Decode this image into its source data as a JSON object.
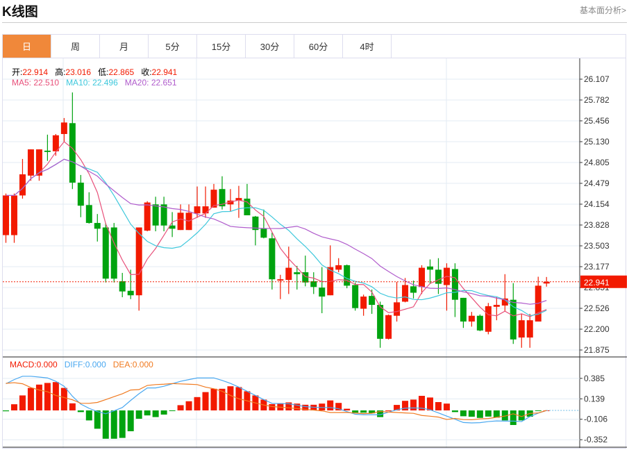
{
  "header": {
    "title": "K线图",
    "link": "基本面分析>"
  },
  "tabs": [
    {
      "label": "日",
      "active": true
    },
    {
      "label": "周"
    },
    {
      "label": "月"
    },
    {
      "label": "5分"
    },
    {
      "label": "15分"
    },
    {
      "label": "30分"
    },
    {
      "label": "60分"
    },
    {
      "label": "4时"
    }
  ],
  "info": {
    "open_label": "开:",
    "open": "22.914",
    "high_label": "高:",
    "high": "23.016",
    "low_label": "低:",
    "low": "22.865",
    "close_label": "收:",
    "close": "22.941",
    "ma5": "MA5: 22.510",
    "ma10": "MA10: 22.496",
    "ma20": "MA20: 22.651",
    "macd": "MACD:0.000",
    "diff": "DIFF:0.000",
    "dea": "DEA:0.000"
  },
  "colors": {
    "up": "#f21a00",
    "down": "#00a30f",
    "ma5": "#e8507a",
    "ma10": "#3ec8dc",
    "ma20": "#b05ccc",
    "diff": "#4aa8f0",
    "dea": "#f07a20",
    "accent": "#f0883a"
  },
  "chart_data": [
    {
      "type": "candlestick",
      "ylim": [
        21.875,
        26.107
      ],
      "y_ticks": [
        "26.107",
        "25.782",
        "25.456",
        "25.130",
        "24.805",
        "24.479",
        "24.154",
        "23.828",
        "23.503",
        "23.177",
        "22.851",
        "22.526",
        "22.200",
        "21.875"
      ],
      "last_price": "22.941",
      "ohlc": [
        [
          23.67,
          24.32,
          23.55,
          24.29
        ],
        [
          23.67,
          24.32,
          23.55,
          24.29
        ],
        [
          24.29,
          24.86,
          24.24,
          24.62
        ],
        [
          24.6,
          25.01,
          24.52,
          25.01
        ],
        [
          24.6,
          25.01,
          24.52,
          25.01
        ],
        [
          24.99,
          25.24,
          24.83,
          24.97
        ],
        [
          24.98,
          25.25,
          24.91,
          25.23
        ],
        [
          25.25,
          25.5,
          25.12,
          25.43
        ],
        [
          25.42,
          25.9,
          24.39,
          24.49
        ],
        [
          24.49,
          24.61,
          23.95,
          24.13
        ],
        [
          24.14,
          24.34,
          23.85,
          23.86
        ],
        [
          23.86,
          24.0,
          23.57,
          23.77
        ],
        [
          23.79,
          23.86,
          22.93,
          22.99
        ],
        [
          23.79,
          23.86,
          22.93,
          22.99
        ],
        [
          22.95,
          23.08,
          22.7,
          22.79
        ],
        [
          22.8,
          23.13,
          22.67,
          22.73
        ],
        [
          22.73,
          23.79,
          22.49,
          23.79
        ],
        [
          23.74,
          24.2,
          23.73,
          24.18
        ],
        [
          24.15,
          24.27,
          23.73,
          23.82
        ],
        [
          24.15,
          24.27,
          23.73,
          23.82
        ],
        [
          23.82,
          24.03,
          23.64,
          23.77
        ],
        [
          23.75,
          24.15,
          23.75,
          24.02
        ],
        [
          23.75,
          24.15,
          23.75,
          24.02
        ],
        [
          24.01,
          24.43,
          23.94,
          24.12
        ],
        [
          24.01,
          24.43,
          23.94,
          24.12
        ],
        [
          24.1,
          24.47,
          24.1,
          24.38
        ],
        [
          24.39,
          24.59,
          24.07,
          24.12
        ],
        [
          24.15,
          24.39,
          24.04,
          24.21
        ],
        [
          24.21,
          24.44,
          23.94,
          24.25
        ],
        [
          24.24,
          24.47,
          23.98,
          23.98
        ],
        [
          23.96,
          23.97,
          23.51,
          23.75
        ],
        [
          23.77,
          24.07,
          23.62,
          23.63
        ],
        [
          23.62,
          23.71,
          22.82,
          22.98
        ],
        [
          22.96,
          23.05,
          22.67,
          22.98
        ],
        [
          22.97,
          23.49,
          22.75,
          23.16
        ],
        [
          23.09,
          23.19,
          22.82,
          23.06
        ],
        [
          23.09,
          23.35,
          22.87,
          22.93
        ],
        [
          22.95,
          23.09,
          22.75,
          22.86
        ],
        [
          22.85,
          23.17,
          22.45,
          22.71
        ],
        [
          22.73,
          23.51,
          22.73,
          23.17
        ],
        [
          23.13,
          23.31,
          23.09,
          23.2
        ],
        [
          23.2,
          23.21,
          22.84,
          22.88
        ],
        [
          22.89,
          22.93,
          22.49,
          22.53
        ],
        [
          22.52,
          22.74,
          22.41,
          22.71
        ],
        [
          22.72,
          22.82,
          22.44,
          22.58
        ],
        [
          22.58,
          22.63,
          21.91,
          22.05
        ],
        [
          22.05,
          22.43,
          22.04,
          22.42
        ],
        [
          22.41,
          22.94,
          22.32,
          22.62
        ],
        [
          22.63,
          23.0,
          22.62,
          22.89
        ],
        [
          22.87,
          22.96,
          22.68,
          22.77
        ],
        [
          22.86,
          23.2,
          22.75,
          23.16
        ],
        [
          23.18,
          23.29,
          22.91,
          23.13
        ],
        [
          23.13,
          23.31,
          22.75,
          22.91
        ],
        [
          22.89,
          23.23,
          22.49,
          23.16
        ],
        [
          23.14,
          23.23,
          22.39,
          22.66
        ],
        [
          22.69,
          22.69,
          22.22,
          22.32
        ],
        [
          22.32,
          22.47,
          22.24,
          22.41
        ],
        [
          22.41,
          22.43,
          22.17,
          22.18
        ],
        [
          22.16,
          22.61,
          22.12,
          22.56
        ],
        [
          22.55,
          22.7,
          22.34,
          22.58
        ],
        [
          22.57,
          23.06,
          22.48,
          22.68
        ],
        [
          22.66,
          22.92,
          21.97,
          22.04
        ],
        [
          22.07,
          22.44,
          21.91,
          22.34
        ],
        [
          22.07,
          22.44,
          21.91,
          22.34
        ],
        [
          22.32,
          23.02,
          22.32,
          22.88
        ],
        [
          22.914,
          23.016,
          22.865,
          22.941
        ]
      ],
      "series": [
        {
          "name": "MA5"
        },
        {
          "name": "MA10"
        },
        {
          "name": "MA20"
        }
      ]
    },
    {
      "type": "bar",
      "ylim": [
        -0.45,
        0.48
      ],
      "y_ticks": [
        "0.385",
        "0.139",
        "-0.106",
        "-0.352"
      ],
      "macd": [
        -0.01,
        0.074,
        0.18,
        0.27,
        0.31,
        0.33,
        0.34,
        0.27,
        0.085,
        -0.02,
        -0.12,
        -0.22,
        -0.34,
        -0.34,
        -0.33,
        -0.25,
        -0.1,
        -0.06,
        -0.08,
        -0.05,
        -0.005,
        0.063,
        0.11,
        0.16,
        0.22,
        0.26,
        0.26,
        0.29,
        0.28,
        0.23,
        0.18,
        0.13,
        0.076,
        0.087,
        0.096,
        0.082,
        0.068,
        0.068,
        0.082,
        0.12,
        0.09,
        0.02,
        -0.027,
        -0.027,
        -0.035,
        -0.08,
        0,
        0.066,
        0.115,
        0.13,
        0.175,
        0.155,
        0.1,
        0.082,
        -0.02,
        -0.07,
        -0.076,
        -0.09,
        -0.074,
        -0.087,
        -0.12,
        -0.175,
        -0.12,
        -0.076,
        -0.005,
        0
      ],
      "diff": [
        0.32,
        0.37,
        0.41,
        0.41,
        0.4,
        0.39,
        0.35,
        0.29,
        0.17,
        0.076,
        0.025,
        -0.014,
        -0.04,
        -0.005,
        0.035,
        0.12,
        0.2,
        0.27,
        0.27,
        0.29,
        0.32,
        0.35,
        0.37,
        0.39,
        0.39,
        0.39,
        0.36,
        0.325,
        0.28,
        0.23,
        0.18,
        0.13,
        0.085,
        0.082,
        0.08,
        0.063,
        0.046,
        0.038,
        0.035,
        0.035,
        0.02,
        -0.014,
        -0.046,
        -0.052,
        -0.052,
        -0.052,
        -0.02,
        0.008,
        0.027,
        0.03,
        0.027,
        0.008,
        -0.03,
        -0.068,
        -0.106,
        -0.145,
        -0.15,
        -0.147,
        -0.134,
        -0.126,
        -0.128,
        -0.128,
        -0.134,
        -0.074,
        -0.033,
        0
      ]
    }
  ]
}
